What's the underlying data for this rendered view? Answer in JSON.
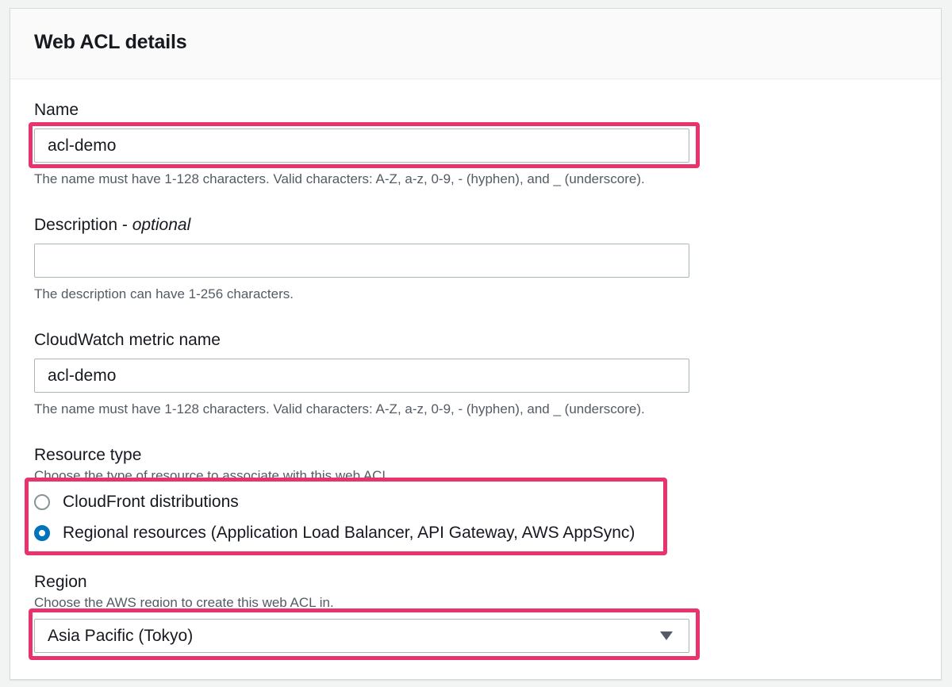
{
  "panel": {
    "title": "Web ACL details"
  },
  "name_field": {
    "label": "Name",
    "value": "acl-demo",
    "hint": "The name must have 1-128 characters. Valid characters: A-Z, a-z, 0-9, - (hyphen), and _ (underscore)."
  },
  "description_field": {
    "label": "Description - ",
    "label_optional": "optional",
    "value": "",
    "hint": "The description can have 1-256 characters."
  },
  "metric_field": {
    "label": "CloudWatch metric name",
    "value": "acl-demo",
    "hint": "The name must have 1-128 characters. Valid characters: A-Z, a-z, 0-9, - (hyphen), and _ (underscore)."
  },
  "resource_type": {
    "label": "Resource type",
    "hint": "Choose the type of resource to associate with this web ACL.",
    "options": [
      {
        "label": "CloudFront distributions",
        "checked": false
      },
      {
        "label": "Regional resources (Application Load Balancer, API Gateway, AWS AppSync)",
        "checked": true
      }
    ]
  },
  "region": {
    "label": "Region",
    "hint": "Choose the AWS region to create this web ACL in.",
    "selected": "Asia Pacific (Tokyo)"
  },
  "colors": {
    "highlight": "#e8336d",
    "radio_checked": "#0073bb",
    "hint_text": "#545b64"
  }
}
